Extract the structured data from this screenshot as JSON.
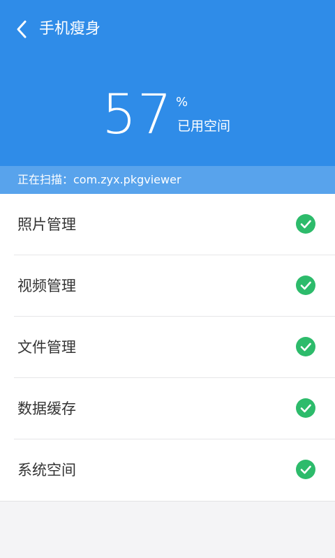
{
  "header": {
    "title": "手机瘦身",
    "back_icon": "chevron-left-icon",
    "bg_color": "#2f8ce8"
  },
  "usage": {
    "percent": "57",
    "unit": "%",
    "label": "已用空间"
  },
  "scan": {
    "text": "正在扫描：com.zyx.pkgviewer",
    "bg_color": "#58a3ec"
  },
  "items": [
    {
      "label": "照片管理",
      "status_icon": "check-circle-icon"
    },
    {
      "label": "视频管理",
      "status_icon": "check-circle-icon"
    },
    {
      "label": "文件管理",
      "status_icon": "check-circle-icon"
    },
    {
      "label": "数据缓存",
      "status_icon": "check-circle-icon"
    },
    {
      "label": "系统空间",
      "status_icon": "check-circle-icon"
    }
  ],
  "colors": {
    "check": "#2dbb6b"
  }
}
